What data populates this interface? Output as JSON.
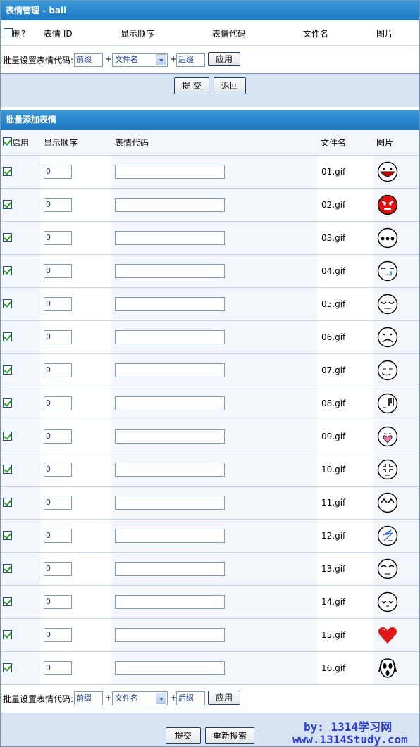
{
  "manage": {
    "title": "表情管理 - ball",
    "headers": {
      "del": "删?",
      "id": "表情 ID",
      "order": "显示顺序",
      "code": "表情代码",
      "file": "文件名",
      "image": "图片"
    },
    "batch_label": "批量设置表情代码:",
    "prefix": "前缀",
    "select_value": "文件名",
    "suffix": "后缀",
    "apply": "应用",
    "submit": "提 交",
    "back": "返回"
  },
  "add": {
    "title": "批量添加表情",
    "headers": {
      "enable": "启用",
      "order": "显示顺序",
      "code": "表情代码",
      "file": "文件名",
      "image": "图片"
    },
    "rows": [
      {
        "enabled": true,
        "order": "0",
        "code": "",
        "file": "01.gif",
        "icon": "big-mouth-smiley-icon"
      },
      {
        "enabled": true,
        "order": "0",
        "code": "",
        "file": "02.gif",
        "icon": "angry-red-face-icon"
      },
      {
        "enabled": true,
        "order": "0",
        "code": "",
        "file": "03.gif",
        "icon": "ellipsis-face-icon"
      },
      {
        "enabled": true,
        "order": "0",
        "code": "",
        "file": "04.gif",
        "icon": "crying-face-icon"
      },
      {
        "enabled": true,
        "order": "0",
        "code": "",
        "file": "05.gif",
        "icon": "cool-face-icon"
      },
      {
        "enabled": true,
        "order": "0",
        "code": "",
        "file": "06.gif",
        "icon": "sad-face-icon"
      },
      {
        "enabled": true,
        "order": "0",
        "code": "",
        "file": "07.gif",
        "icon": "sleepy-face-icon"
      },
      {
        "enabled": true,
        "order": "0",
        "code": "",
        "file": "08.gif",
        "icon": "sweat-face-icon"
      },
      {
        "enabled": true,
        "order": "0",
        "code": "",
        "file": "09.gif",
        "icon": "heart-face-icon"
      },
      {
        "enabled": true,
        "order": "0",
        "code": "",
        "file": "10.gif",
        "icon": "anger-mark-face-icon"
      },
      {
        "enabled": true,
        "order": "0",
        "code": "",
        "file": "11.gif",
        "icon": "happy-eyes-face-icon"
      },
      {
        "enabled": true,
        "order": "0",
        "code": "",
        "file": "12.gif",
        "icon": "lightning-face-icon"
      },
      {
        "enabled": true,
        "order": "0",
        "code": "",
        "file": "13.gif",
        "icon": "smug-face-icon"
      },
      {
        "enabled": true,
        "order": "0",
        "code": "",
        "file": "14.gif",
        "icon": "worried-face-icon"
      },
      {
        "enabled": true,
        "order": "0",
        "code": "",
        "file": "15.gif",
        "icon": "red-heart-icon"
      },
      {
        "enabled": true,
        "order": "0",
        "code": "",
        "file": "16.gif",
        "icon": "scream-mask-icon"
      }
    ],
    "batch_label": "批量设置表情代码:",
    "prefix": "前缀",
    "select_value": "文件名",
    "suffix": "后缀",
    "apply": "应用",
    "submit": "提交",
    "research": "重新搜索"
  },
  "watermark": {
    "line1": "by: 1314学习网",
    "line2": "www.1314Study.com"
  },
  "colors": {
    "header_bar": "#1b78c2",
    "check": "#21a121",
    "footer": "#d7e3f1",
    "watermark": "#2c3fd8"
  }
}
